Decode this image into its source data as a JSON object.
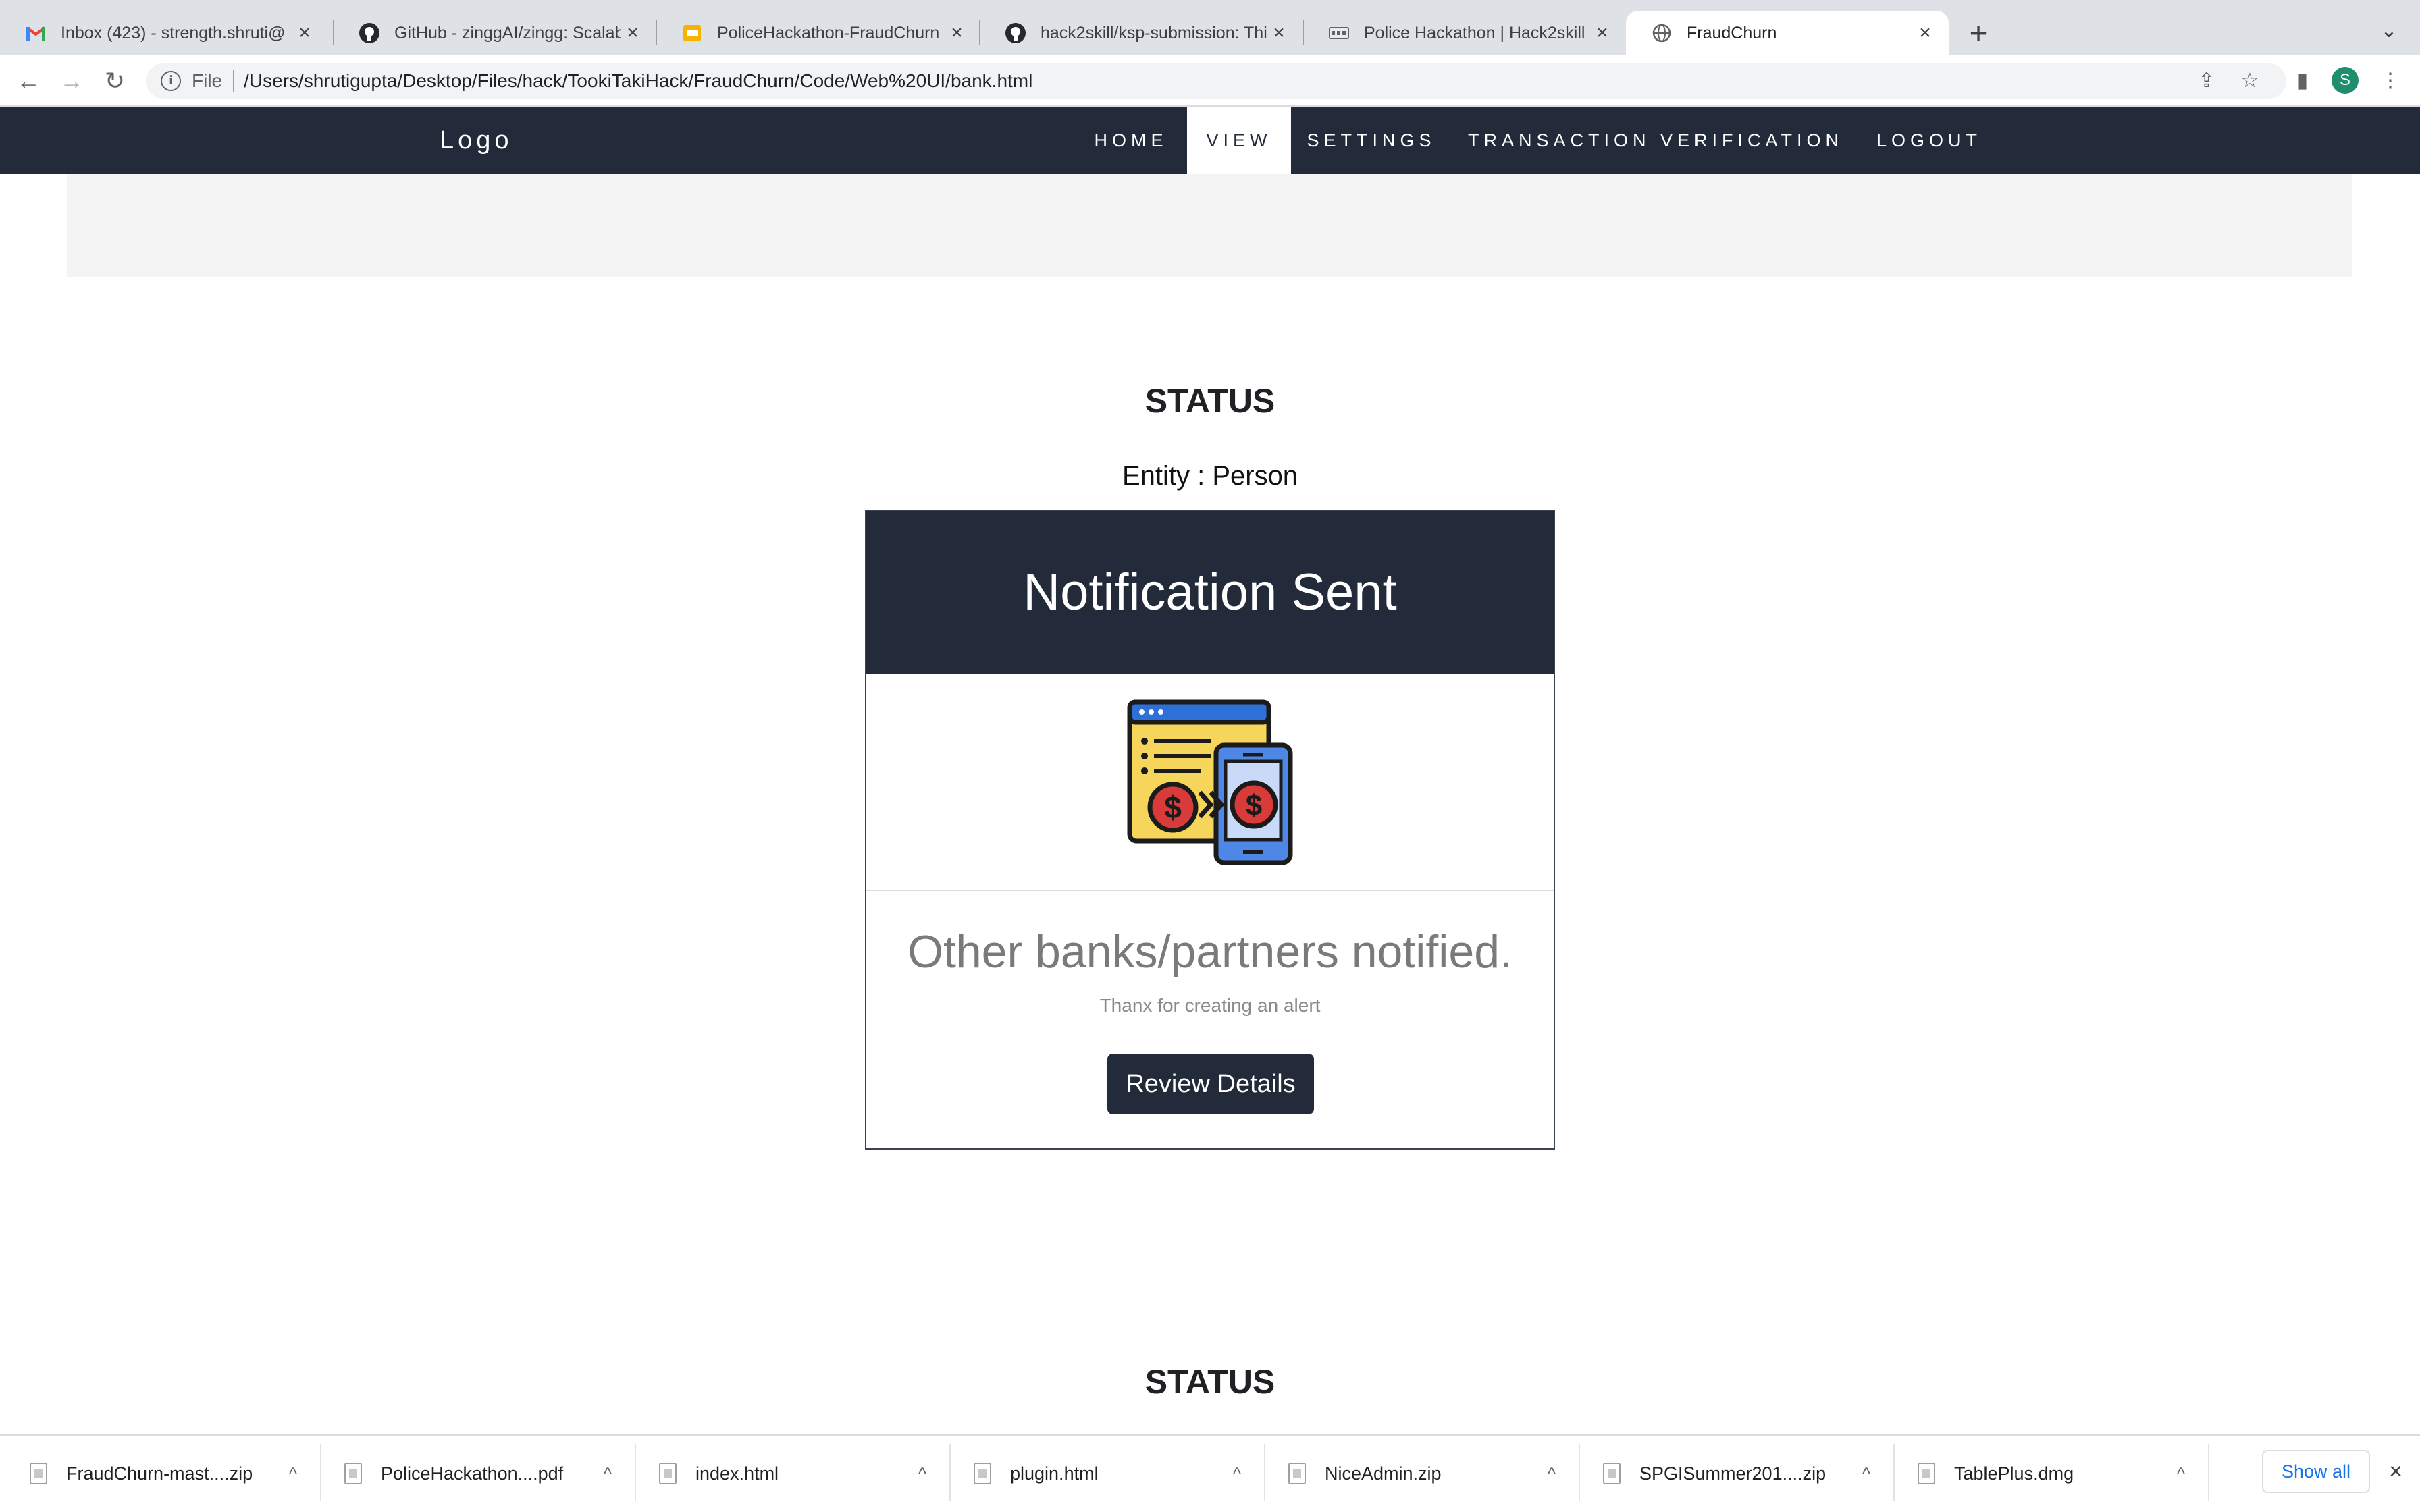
{
  "browser": {
    "tabs": [
      {
        "title": "Inbox (423) - strength.shruti@",
        "icon": "gmail-icon"
      },
      {
        "title": "GitHub - zinggAI/zingg: Scalab",
        "icon": "github-icon"
      },
      {
        "title": "PoliceHackathon-FraudChurn -",
        "icon": "slides-icon"
      },
      {
        "title": "hack2skill/ksp-submission: Thi",
        "icon": "github-icon"
      },
      {
        "title": "Police Hackathon | Hack2skill |",
        "icon": "hack2skill-icon"
      },
      {
        "title": "FraudChurn",
        "icon": "globe-icon",
        "active": true
      }
    ],
    "address": {
      "scheme": "File",
      "url": "/Users/shrutigupta/Desktop/Files/hack/TookiTakiHack/FraudChurn/Code/Web%20UI/bank.html"
    },
    "profile_initial": "S"
  },
  "nav": {
    "logo": "Logo",
    "links": [
      "HOME",
      "VIEW",
      "SETTINGS",
      "TRANSACTION VERIFICATION",
      "LOGOUT"
    ],
    "active_link": "VIEW"
  },
  "main": {
    "status_heading": "STATUS",
    "entity": "Entity : Person",
    "card": {
      "header": "Notification Sent",
      "image": "money-transfer-illustration",
      "message": "Other banks/partners notified.",
      "subtext": "Thanx for creating an alert",
      "button": "Review Details"
    },
    "status_heading_2": "STATUS"
  },
  "downloads": {
    "items": [
      {
        "name": "FraudChurn-mast....zip"
      },
      {
        "name": "PoliceHackathon....pdf"
      },
      {
        "name": "index.html"
      },
      {
        "name": "plugin.html"
      },
      {
        "name": "NiceAdmin.zip"
      },
      {
        "name": "SPGISummer201....zip"
      },
      {
        "name": "TablePlus.dmg"
      }
    ],
    "show_all": "Show all"
  },
  "colors": {
    "navbar": "#232b3b",
    "banner": "#f4f4f4",
    "button": "#232b3b",
    "tab_strip": "#dee1e6"
  }
}
